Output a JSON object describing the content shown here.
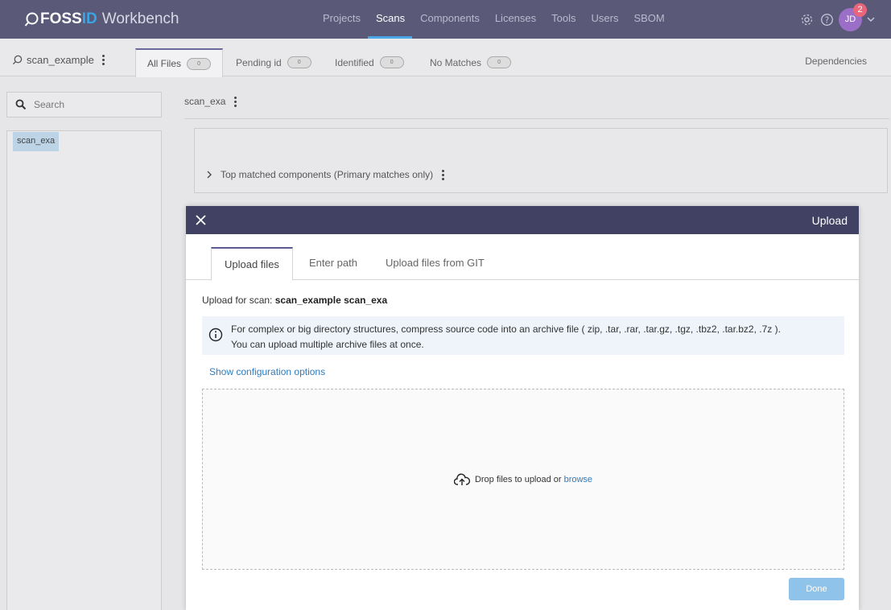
{
  "logo": {
    "foss": "FOSS",
    "id": "ID",
    "workbench": "Workbench"
  },
  "nav": {
    "items": [
      "Projects",
      "Scans",
      "Components",
      "Licenses",
      "Tools",
      "Users",
      "SBOM"
    ],
    "active": "Scans"
  },
  "user": {
    "initials": "JD",
    "notification_count": "2"
  },
  "icons": [
    "search-icon",
    "gear-icon",
    "help-icon",
    "chevron-down-icon",
    "kebab-icon",
    "close-icon",
    "info-icon",
    "cloud-upload-icon",
    "chevron-right-icon"
  ],
  "colors": {
    "header": "#5a5a78",
    "modal_header": "#414163",
    "accent": "#4aa8e8",
    "link": "#2f7bbd",
    "done_button": "#8fc3ea",
    "badge": "#e8657a",
    "avatar": "#9b6fc8"
  },
  "subbar": {
    "scan_name": "scan_example",
    "tabs": [
      {
        "label": "All Files",
        "count": "0"
      },
      {
        "label": "Pending id",
        "count": "0"
      },
      {
        "label": "Identified",
        "count": "0"
      },
      {
        "label": "No Matches",
        "count": "0"
      }
    ],
    "dependencies": "Dependencies"
  },
  "sidebar": {
    "search_placeholder": "Search",
    "tree_node": "scan_exa"
  },
  "main": {
    "breadcrumb": "scan_exa",
    "top_components": "Top matched components (Primary matches only)"
  },
  "modal": {
    "title": "Upload",
    "tabs": [
      "Upload files",
      "Enter path",
      "Upload files from GIT"
    ],
    "upload_for_label": "Upload for scan: ",
    "upload_for_value": "scan_example scan_exa",
    "info_line1": "For complex or big directory structures, compress source code into an archive file ( zip, .tar, .rar, .tar.gz, .tgz, .tbz2, .tar.bz2, .7z ).",
    "info_line2": "You can upload multiple archive files at once.",
    "config_link": "Show configuration options",
    "drop_text": "Drop files to upload or",
    "browse": "browse",
    "done": "Done"
  }
}
